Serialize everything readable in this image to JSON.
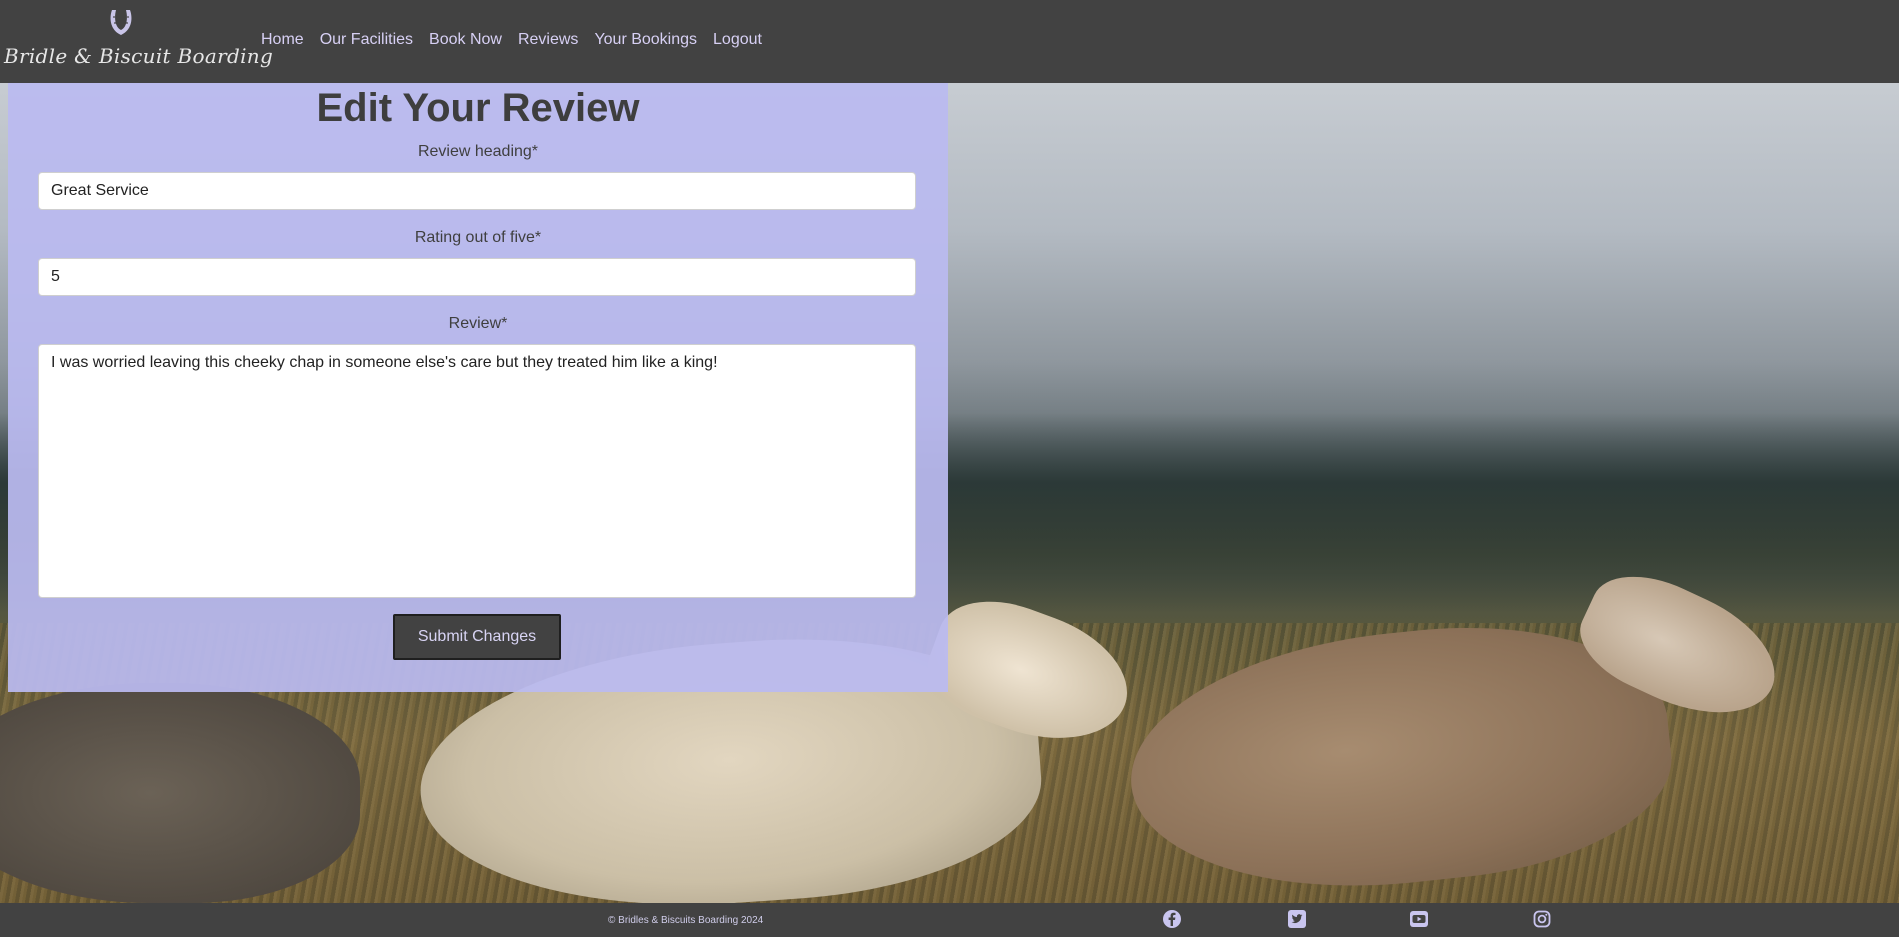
{
  "brand": {
    "name": "Bridle & Biscuit Boarding",
    "logo_icon": "horseshoe-icon"
  },
  "nav": {
    "items": [
      "Home",
      "Our Facilities",
      "Book Now",
      "Reviews",
      "Your Bookings",
      "Logout"
    ]
  },
  "form": {
    "title": "Edit Your Review",
    "heading_label": "Review heading*",
    "heading_value": "Great Service",
    "rating_label": "Rating out of five*",
    "rating_value": "5",
    "review_label": "Review*",
    "review_value": "I was worried leaving this cheeky chap in someone else's care but they treated him like a king!",
    "submit_label": "Submit Changes"
  },
  "footer": {
    "copyright": "© Bridles & Biscuits Boarding 2024",
    "social_icons": [
      "facebook-icon",
      "twitter-icon",
      "youtube-icon",
      "instagram-icon"
    ]
  },
  "colors": {
    "navbar": "#424242",
    "nav_link": "#d7d0f4",
    "panel": "#babaf0",
    "button": "#424242"
  }
}
